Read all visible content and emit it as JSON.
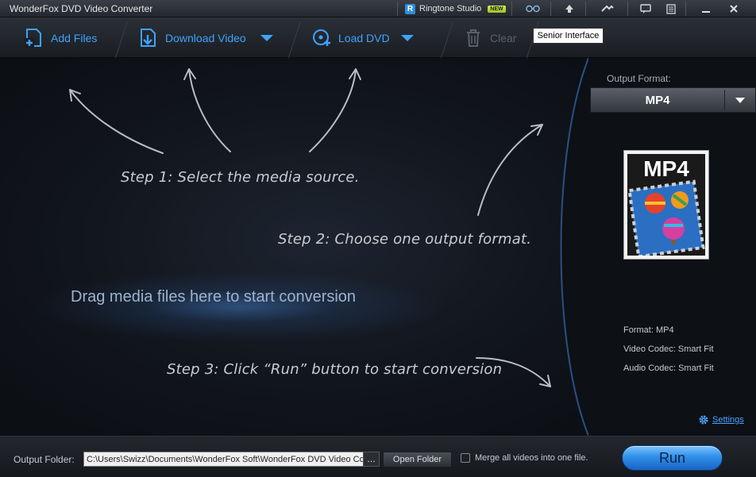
{
  "window": {
    "title": "WonderFox DVD Video Converter",
    "ringtone_label": "Ringtone Studio",
    "new_badge": "NEW"
  },
  "toolbar": {
    "add_files": "Add Files",
    "download_video": "Download Video",
    "load_dvd": "Load DVD",
    "clear": "Clear",
    "tooltip": "Senior Interface"
  },
  "main": {
    "step1": "Step 1: Select the media source.",
    "step2": "Step 2: Choose one output format.",
    "step3": "Step 3: Click “Run” button to start conversion",
    "drag_hint": "Drag media files here to start conversion"
  },
  "right_panel": {
    "output_format_label": "Output Format:",
    "selected_format": "MP4",
    "format_badge": "MP4",
    "format_info": "Format: MP4",
    "video_codec": "Video Codec: Smart Fit",
    "audio_codec": "Audio Codec: Smart Fit",
    "settings_label": "Settings"
  },
  "bottom": {
    "output_folder_label": "Output Folder:",
    "output_path": "C:\\Users\\Swizz\\Documents\\WonderFox Soft\\WonderFox DVD Video Con",
    "browse_label": "…",
    "open_folder": "Open Folder",
    "merge_label": "Merge all videos into one file.",
    "merge_checked": false,
    "run_label": "Run"
  },
  "colors": {
    "accent_blue": "#3ea3ff",
    "run_button": "#2f8fe8"
  }
}
